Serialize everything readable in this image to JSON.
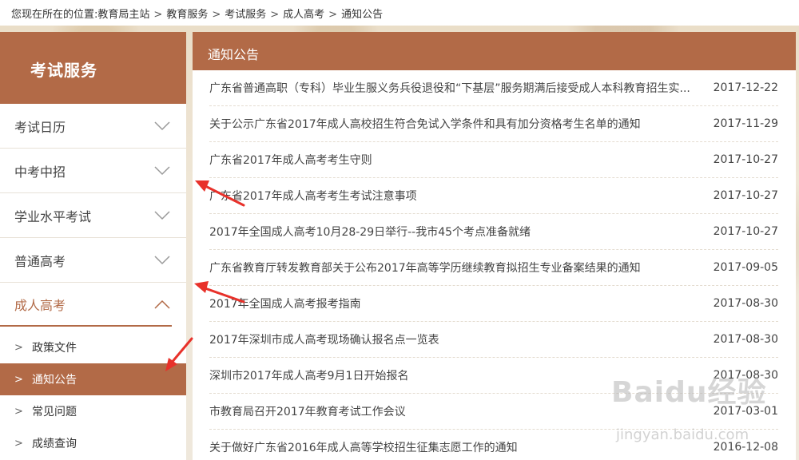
{
  "breadcrumb": {
    "prefix": "您现在所在的位置: ",
    "items": [
      "教育局主站",
      "教育服务",
      "考试服务",
      "成人高考",
      "通知公告"
    ],
    "separator": ">"
  },
  "sidebar": {
    "title": "考试服务",
    "categories": [
      {
        "label": "考试日历",
        "expanded": false
      },
      {
        "label": "中考中招",
        "expanded": false
      },
      {
        "label": "学业水平考试",
        "expanded": false
      },
      {
        "label": "普通高考",
        "expanded": false
      },
      {
        "label": "成人高考",
        "expanded": true
      }
    ],
    "sub_items": [
      {
        "label": "政策文件",
        "active": false
      },
      {
        "label": "通知公告",
        "active": true
      },
      {
        "label": "常见问题",
        "active": false
      },
      {
        "label": "成绩查询",
        "active": false
      }
    ]
  },
  "main": {
    "title": "通知公告",
    "news": [
      {
        "title": "广东省普通高职（专科）毕业生服义务兵役退役和“下基层”服务期满后接受成人本科教育招生实...",
        "date": "2017-12-22"
      },
      {
        "title": "关于公示广东省2017年成人高校招生符合免试入学条件和具有加分资格考生名单的通知",
        "date": "2017-11-29"
      },
      {
        "title": "广东省2017年成人高考考生守则",
        "date": "2017-10-27"
      },
      {
        "title": "广东省2017年成人高考考生考试注意事项",
        "date": "2017-10-27"
      },
      {
        "title": "2017年全国成人高考10月28-29日举行--我市45个考点准备就绪",
        "date": "2017-10-27"
      },
      {
        "title": "广东省教育厅转发教育部关于公布2017年高等学历继续教育拟招生专业备案结果的通知",
        "date": "2017-09-05"
      },
      {
        "title": "2017年全国成人高考报考指南",
        "date": "2017-08-30"
      },
      {
        "title": "2017年深圳市成人高考现场确认报名点一览表",
        "date": "2017-08-30"
      },
      {
        "title": "深圳市2017年成人高考9月1日开始报名",
        "date": "2017-08-30"
      },
      {
        "title": "市教育局召开2017年教育考试工作会议",
        "date": "2017-03-01"
      },
      {
        "title": "关于做好广东省2016年成人高等学校招生征集志愿工作的通知",
        "date": "2016-12-08"
      }
    ]
  },
  "watermark": {
    "logo_text": "Baidu经验",
    "url": "jingyan.baidu.com"
  },
  "colors": {
    "accent": "#b26a47",
    "annotation_arrow": "#e8312a"
  }
}
